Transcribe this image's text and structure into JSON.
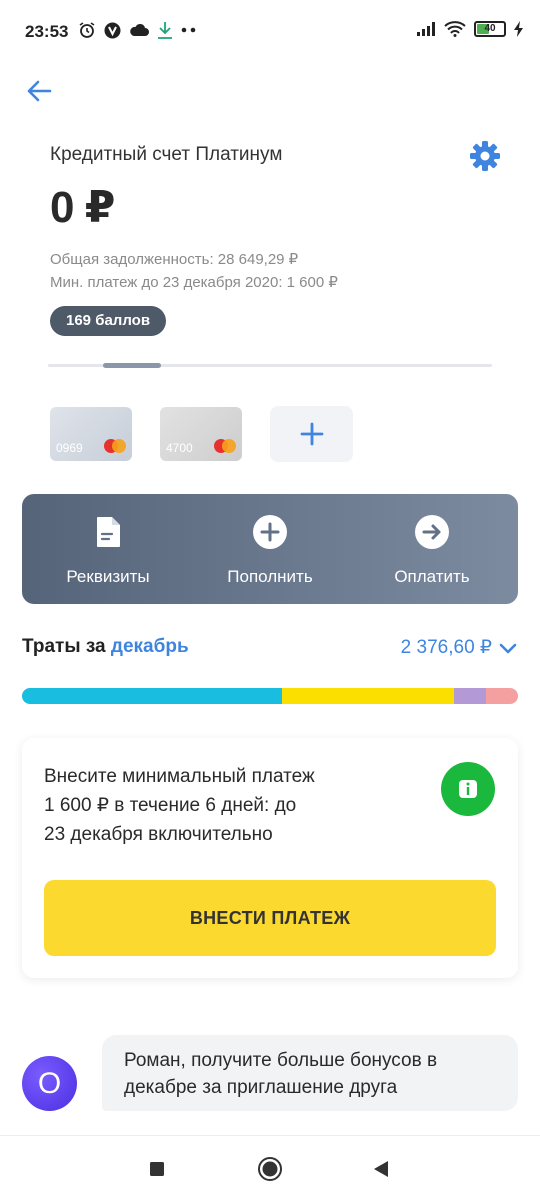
{
  "status": {
    "time": "23:53",
    "battery": "40"
  },
  "account": {
    "name": "Кредитный счет Платинум",
    "balance": "0 ₽",
    "total_debt": "Общая задолженность: 28 649,29 ₽",
    "min_payment": "Мин. платеж до 23 декабря 2020: 1 600 ₽",
    "points": "169 баллов"
  },
  "cards": [
    {
      "number": "0969"
    },
    {
      "number": "4700"
    }
  ],
  "actions": [
    {
      "label": "Реквизиты",
      "icon": "document-icon"
    },
    {
      "label": "Пополнить",
      "icon": "plus-circle-icon"
    },
    {
      "label": "Оплатить",
      "icon": "arrow-right-circle-icon"
    }
  ],
  "spending": {
    "title_prefix": "Траты за",
    "month": "декабрь",
    "total": "2 376,60 ₽",
    "segments": [
      {
        "share": 0.525,
        "color": "#18bde0"
      },
      {
        "share": 0.345,
        "color": "#fadf00"
      },
      {
        "share": 0.065,
        "color": "#b39ad6"
      },
      {
        "share": 0.065,
        "color": "#f5a0a0"
      }
    ]
  },
  "notice": {
    "lines": [
      "Внесите минимальный платеж",
      "1 600 ₽ в течение 6 дней: до",
      "23 декабря включительно"
    ],
    "button": "ВНЕСТИ ПЛАТЕЖ"
  },
  "chat": {
    "avatar_letter": "O",
    "lines": [
      "Роман, получите больше бонусов в",
      "декабре за приглашение друга"
    ]
  },
  "colors": {
    "accent": "#3f85e0",
    "pay_button": "#fcd92f",
    "info_green": "#1ab83c"
  }
}
